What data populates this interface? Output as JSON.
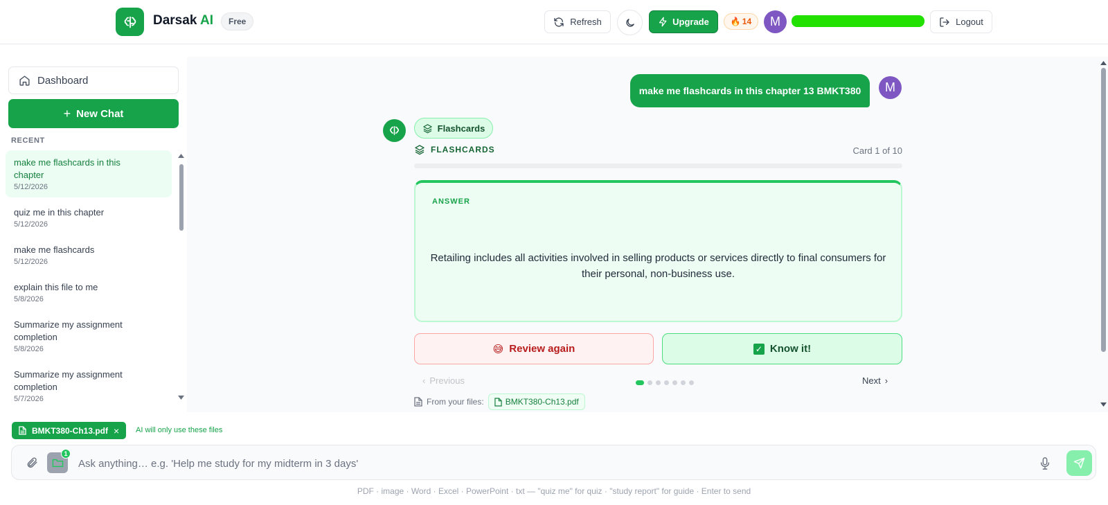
{
  "header": {
    "brand_name": "Darsak",
    "brand_suffix": "AI",
    "plan_badge": "Free",
    "refresh_label": "Refresh",
    "upgrade_label": "Upgrade",
    "streak_count": "14",
    "user_initial": "M",
    "logout_label": "Logout",
    "accent_color": "#16a34a"
  },
  "sidebar": {
    "dashboard_label": "Dashboard",
    "new_chat_label": "New Chat",
    "recent_label": "RECENT",
    "recent": [
      {
        "title": "make me flashcards in this chapter",
        "date": "5/12/2026",
        "active": true
      },
      {
        "title": "quiz me in this chapter",
        "date": "5/12/2026"
      },
      {
        "title": "make me flashcards",
        "date": "5/12/2026"
      },
      {
        "title": "explain this file to me",
        "date": "5/8/2026"
      },
      {
        "title": "Summarize my assignment completion",
        "date": "5/8/2026"
      },
      {
        "title": "Summarize my assignment completion",
        "date": "5/7/2026"
      }
    ]
  },
  "chat": {
    "user_message": "make me flashcards in this chapter 13 BMKT380",
    "user_initial": "M",
    "mode_chip": "Flashcards",
    "flashcards_header": "FLASHCARDS",
    "card_counter": "Card 1 of 10",
    "card_side_label": "ANSWER",
    "card_text": "Retailing includes all activities involved in selling products or services directly to final consumers for their personal, non-business use.",
    "review_label": "Review again",
    "know_label": "Know it!",
    "previous_label": "Previous",
    "next_label": "Next",
    "current_card": 1,
    "dots_visible": 7,
    "from_files_label": "From your files:",
    "source_file": "BMKT380-Ch13.pdf"
  },
  "composer": {
    "attached_file": "BMKT380-Ch13.pdf",
    "attached_note": "AI will only use these files",
    "folder_count": "1",
    "placeholder": "Ask anything… e.g. 'Help me study for my midterm in 3 days'",
    "value": "",
    "hint": "PDF · image · Word · Excel · PowerPoint · txt — \"quiz me\" for quiz · \"study report\" for guide · Enter to send"
  }
}
